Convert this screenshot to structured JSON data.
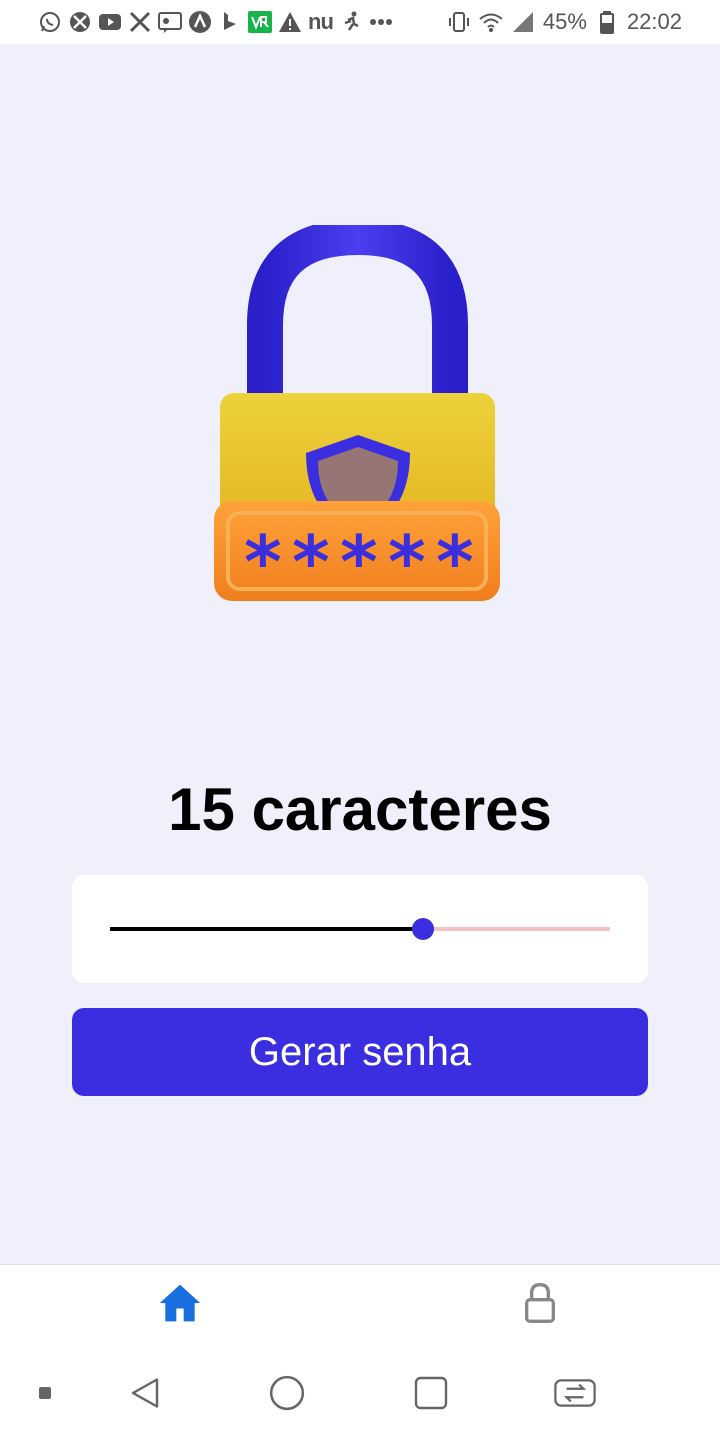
{
  "status_bar": {
    "carrier_text": "nu",
    "battery_percent": "45%",
    "time": "22:02",
    "icons": [
      "whatsapp-icon",
      "xbox-icon",
      "youtube-icon",
      "x-icon",
      "lg-icon",
      "arc-icon",
      "bing-icon",
      "vr-icon",
      "warning-icon",
      "runner-icon",
      "more-icon",
      "vibrate-icon",
      "wifi-icon",
      "signal-icon",
      "battery-icon"
    ]
  },
  "main": {
    "hero_icon": "padlock-password-icon",
    "length_label": "15 caracteres",
    "slider": {
      "value": 15,
      "fill_fraction": 0.625
    },
    "generate_button_label": "Gerar senha"
  },
  "tab_bar": {
    "active_color": "#1a6fe0",
    "inactive_color": "#888888",
    "tabs": [
      {
        "icon": "home-icon",
        "active": true
      },
      {
        "icon": "lock-icon",
        "active": false
      }
    ]
  },
  "system_nav": {
    "icons": [
      "square-dot-icon",
      "back-icon",
      "home-circle-icon",
      "recents-icon",
      "switch-app-icon"
    ]
  },
  "colors": {
    "accent": "#3a2ee0",
    "background": "#f0f0fc",
    "slider_rest": "#f3c3c3"
  }
}
